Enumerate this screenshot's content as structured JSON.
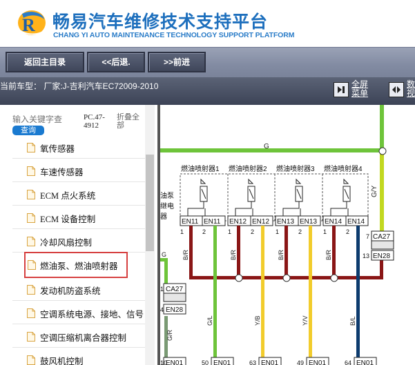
{
  "header": {
    "title": "畅易汽车维修技术支持平台",
    "subtitle": "CHANG YI AUTO MAINTENANCE TECHNOLOGY SUPPORT PLATFORM"
  },
  "toolbar": {
    "home": "返回主目录",
    "back": "<<后退.",
    "forward": ">>前进"
  },
  "modelbar": {
    "current_model": "当前车型：  厂家:J-吉利汽车EC72009-2010",
    "fullscreen": [
      "全屏",
      "菜单"
    ],
    "split": [
      "数",
      "视"
    ]
  },
  "sidebar": {
    "search_placeholder": "输入关键字查",
    "search_button": "查询",
    "pc_code": [
      "PC.47-",
      "4912"
    ],
    "collapse_all": [
      "折叠全",
      "部"
    ],
    "items": [
      {
        "label": "氧传感器"
      },
      {
        "label": "车速传感器"
      },
      {
        "label": "ECM 点火系统"
      },
      {
        "label": "ECM 设备控制"
      },
      {
        "label": "冷却风扇控制"
      },
      {
        "label": "燃油泵、燃油喷射器",
        "selected": true
      },
      {
        "label": "发动机防盗系统"
      },
      {
        "label": "空调系统电源、接地、信号"
      },
      {
        "label": "空调压缩机离合器控制"
      },
      {
        "label": "鼓风机控制"
      }
    ]
  },
  "diagram": {
    "top_wire": "G",
    "injectors": [
      "燃油喷射器1",
      "燃油喷射器2",
      "燃油喷射器3",
      "燃油喷射器4"
    ],
    "injector_pins": [
      [
        "EN11",
        "EN11"
      ],
      [
        "EN12",
        "EN12"
      ],
      [
        "EN13",
        "EN13"
      ],
      [
        "EN14",
        "EN14"
      ]
    ],
    "pump_relay": [
      "油泵",
      "继电",
      "器"
    ],
    "right_wire": "G/Y",
    "right_conn": {
      "pin_top": "7",
      "top": "CA27",
      "pin_bottom": "13",
      "bottom": "EN28"
    },
    "left_conn": {
      "pin_top": "1",
      "top": "CA27",
      "pin_bottom": "4",
      "bottom": "EN28"
    },
    "left_wire": "G",
    "wire_labels_upper": [
      "B/R",
      "B/R",
      "B/R",
      "B/R"
    ],
    "wire_labels_lower": [
      "G/R",
      "G/L",
      "Y/B",
      "Y/V",
      "B/L"
    ],
    "pin_numbers": [
      "1",
      "2",
      "1",
      "2",
      "1",
      "2",
      "1",
      "2"
    ],
    "bottom_pins": [
      "10",
      "50",
      "63",
      "49",
      "64"
    ],
    "bottom_conn": "EN01",
    "colors": {
      "green": "#6ec43a",
      "yellow_green": "#c2d820",
      "yellow": "#f2cc2c",
      "maroon": "#8a1616",
      "navy": "#0d3b6e",
      "gray_green": "#7a9a74"
    }
  }
}
